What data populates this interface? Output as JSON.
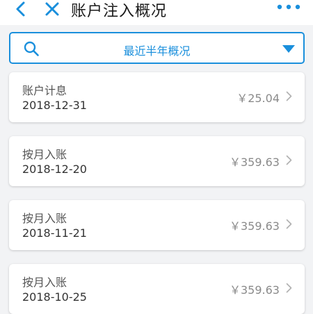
{
  "header": {
    "title": "账户注入概况",
    "back_icon": "chevron-left-icon",
    "close_icon": "close-icon",
    "more_icon": "more-horizontal-icon"
  },
  "filter": {
    "value": "最近半年概况",
    "search_icon": "search-icon",
    "dropdown_icon": "caret-down-icon",
    "accent_color": "#1a8fdc"
  },
  "records": [
    {
      "name": "账户计息",
      "date": "2018-12-31",
      "amount": "￥25.04"
    },
    {
      "name": "按月入账",
      "date": "2018-12-20",
      "amount": "￥359.63"
    },
    {
      "name": "按月入账",
      "date": "2018-11-21",
      "amount": "￥359.63"
    },
    {
      "name": "按月入账",
      "date": "2018-10-25",
      "amount": "￥359.63"
    }
  ]
}
